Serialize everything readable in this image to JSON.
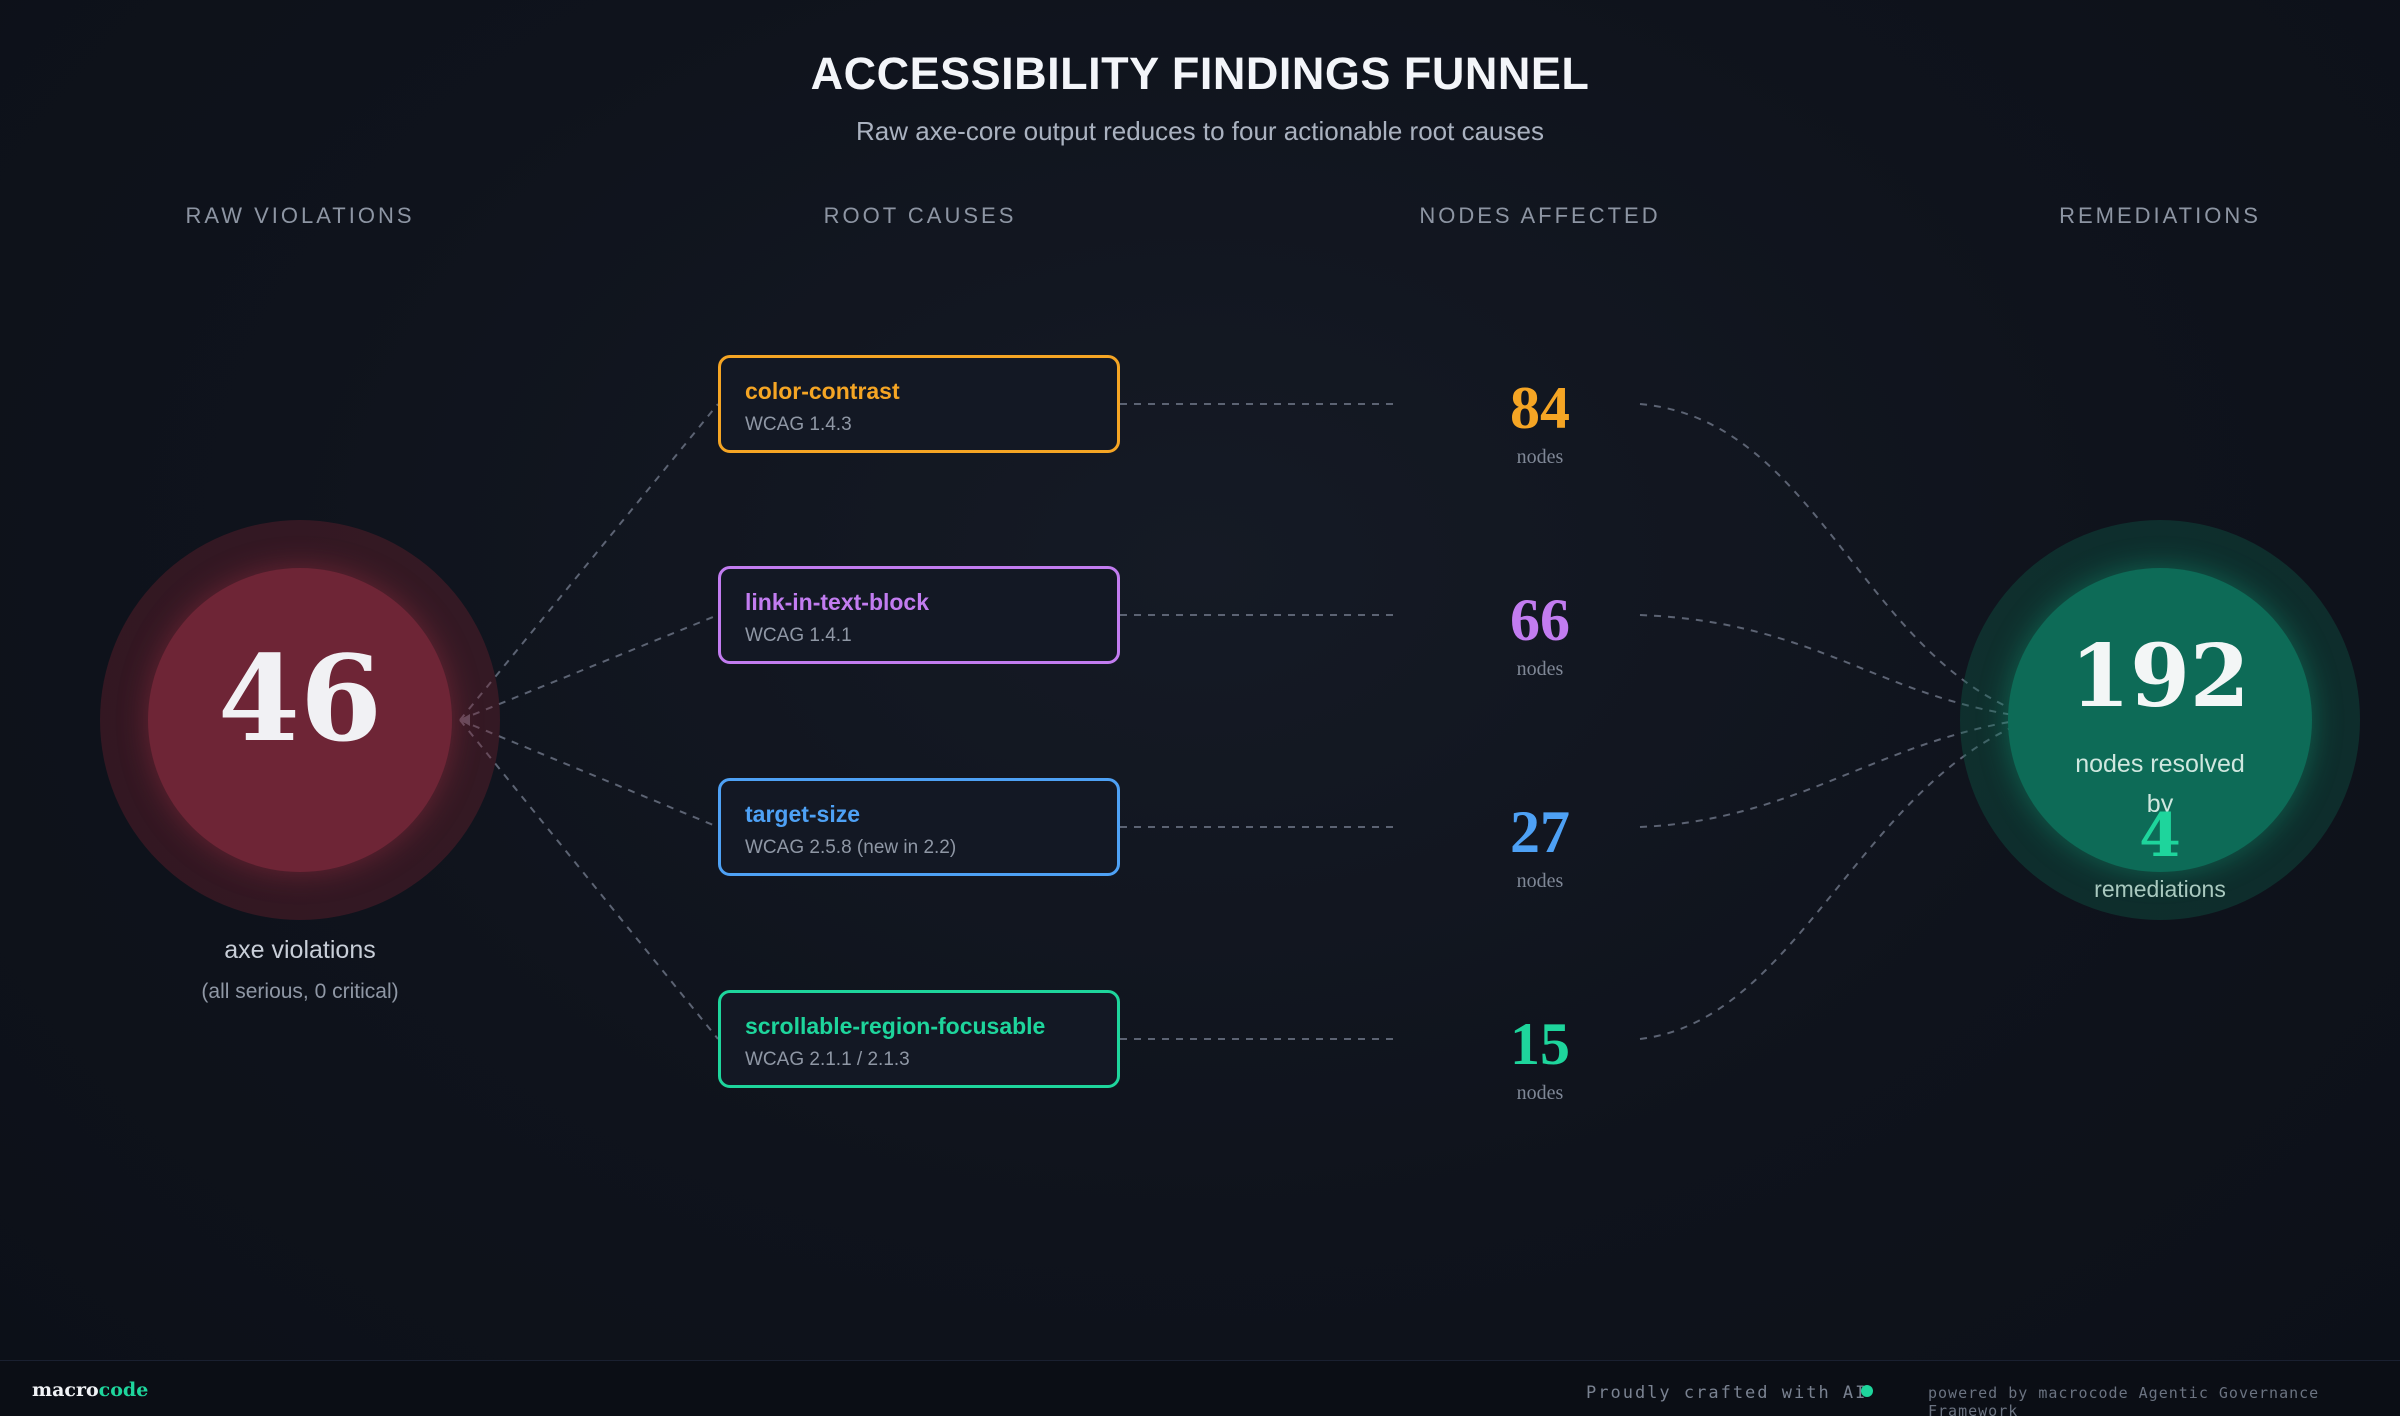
{
  "header": {
    "title": "ACCESSIBILITY FINDINGS FUNNEL",
    "subtitle": "Raw axe-core output reduces to four actionable root causes"
  },
  "columns": [
    "RAW VIOLATIONS",
    "ROOT CAUSES",
    "NODES AFFECTED",
    "REMEDIATIONS"
  ],
  "raw": {
    "value": "46",
    "label": "axe violations",
    "sublabel": "(all serious, 0 critical)",
    "color": "#6e2536"
  },
  "causes": [
    {
      "name": "color-contrast",
      "wcag": "WCAG 1.4.3",
      "nodes": "84",
      "unit": "nodes",
      "color": "#f5a524"
    },
    {
      "name": "link-in-text-block",
      "wcag": "WCAG 1.4.1",
      "nodes": "66",
      "unit": "nodes",
      "color": "#c27cf0"
    },
    {
      "name": "target-size",
      "wcag": "WCAG 2.5.8 (new in 2.2)",
      "nodes": "27",
      "unit": "nodes",
      "color": "#4ea1f5"
    },
    {
      "name": "scrollable-region-focusable",
      "wcag": "WCAG 2.1.1 / 2.1.3",
      "nodes": "15",
      "unit": "nodes",
      "color": "#1ed59c"
    }
  ],
  "remediation": {
    "value": "192",
    "label": "nodes resolved by",
    "count": "4",
    "suffix": "remediations",
    "color": "#0d6b57"
  },
  "footer": {
    "brand_part1": "macro",
    "brand_part2": "code",
    "crafted": "Proudly crafted with AI",
    "powered": "powered by macrocode Agentic Governance Framework"
  }
}
